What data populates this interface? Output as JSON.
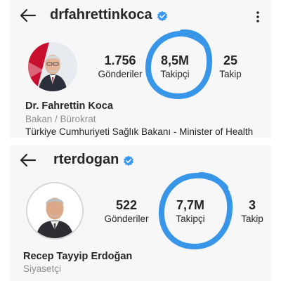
{
  "accent_color": "#3896e8",
  "verified_color": "#3897f0",
  "profiles": [
    {
      "username": "drfahrettinkoca",
      "verified": true,
      "stats": [
        {
          "value": "1.756",
          "label": "Gönderiler"
        },
        {
          "value": "8,5M",
          "label": "Takipçi"
        },
        {
          "value": "25",
          "label": "Takip"
        }
      ],
      "name": "Dr. Fahrettin Koca",
      "category": "Bakan / Bürokrat",
      "bio": "Türkiye Cumhuriyeti Sağlık Bakanı - Minister of Health"
    },
    {
      "username": "rterdogan",
      "verified": true,
      "stats": [
        {
          "value": "522",
          "label": "Gönderiler"
        },
        {
          "value": "7,7M",
          "label": "Takipçi"
        },
        {
          "value": "3",
          "label": "Takip"
        }
      ],
      "name": "Recep Tayyip Erdoğan",
      "category": "Siyasetçi"
    }
  ],
  "icons": {
    "back": "back-arrow-icon",
    "verified": "verified-badge-icon",
    "menu": "more-options-icon",
    "highlight": "hand-drawn-circle"
  }
}
